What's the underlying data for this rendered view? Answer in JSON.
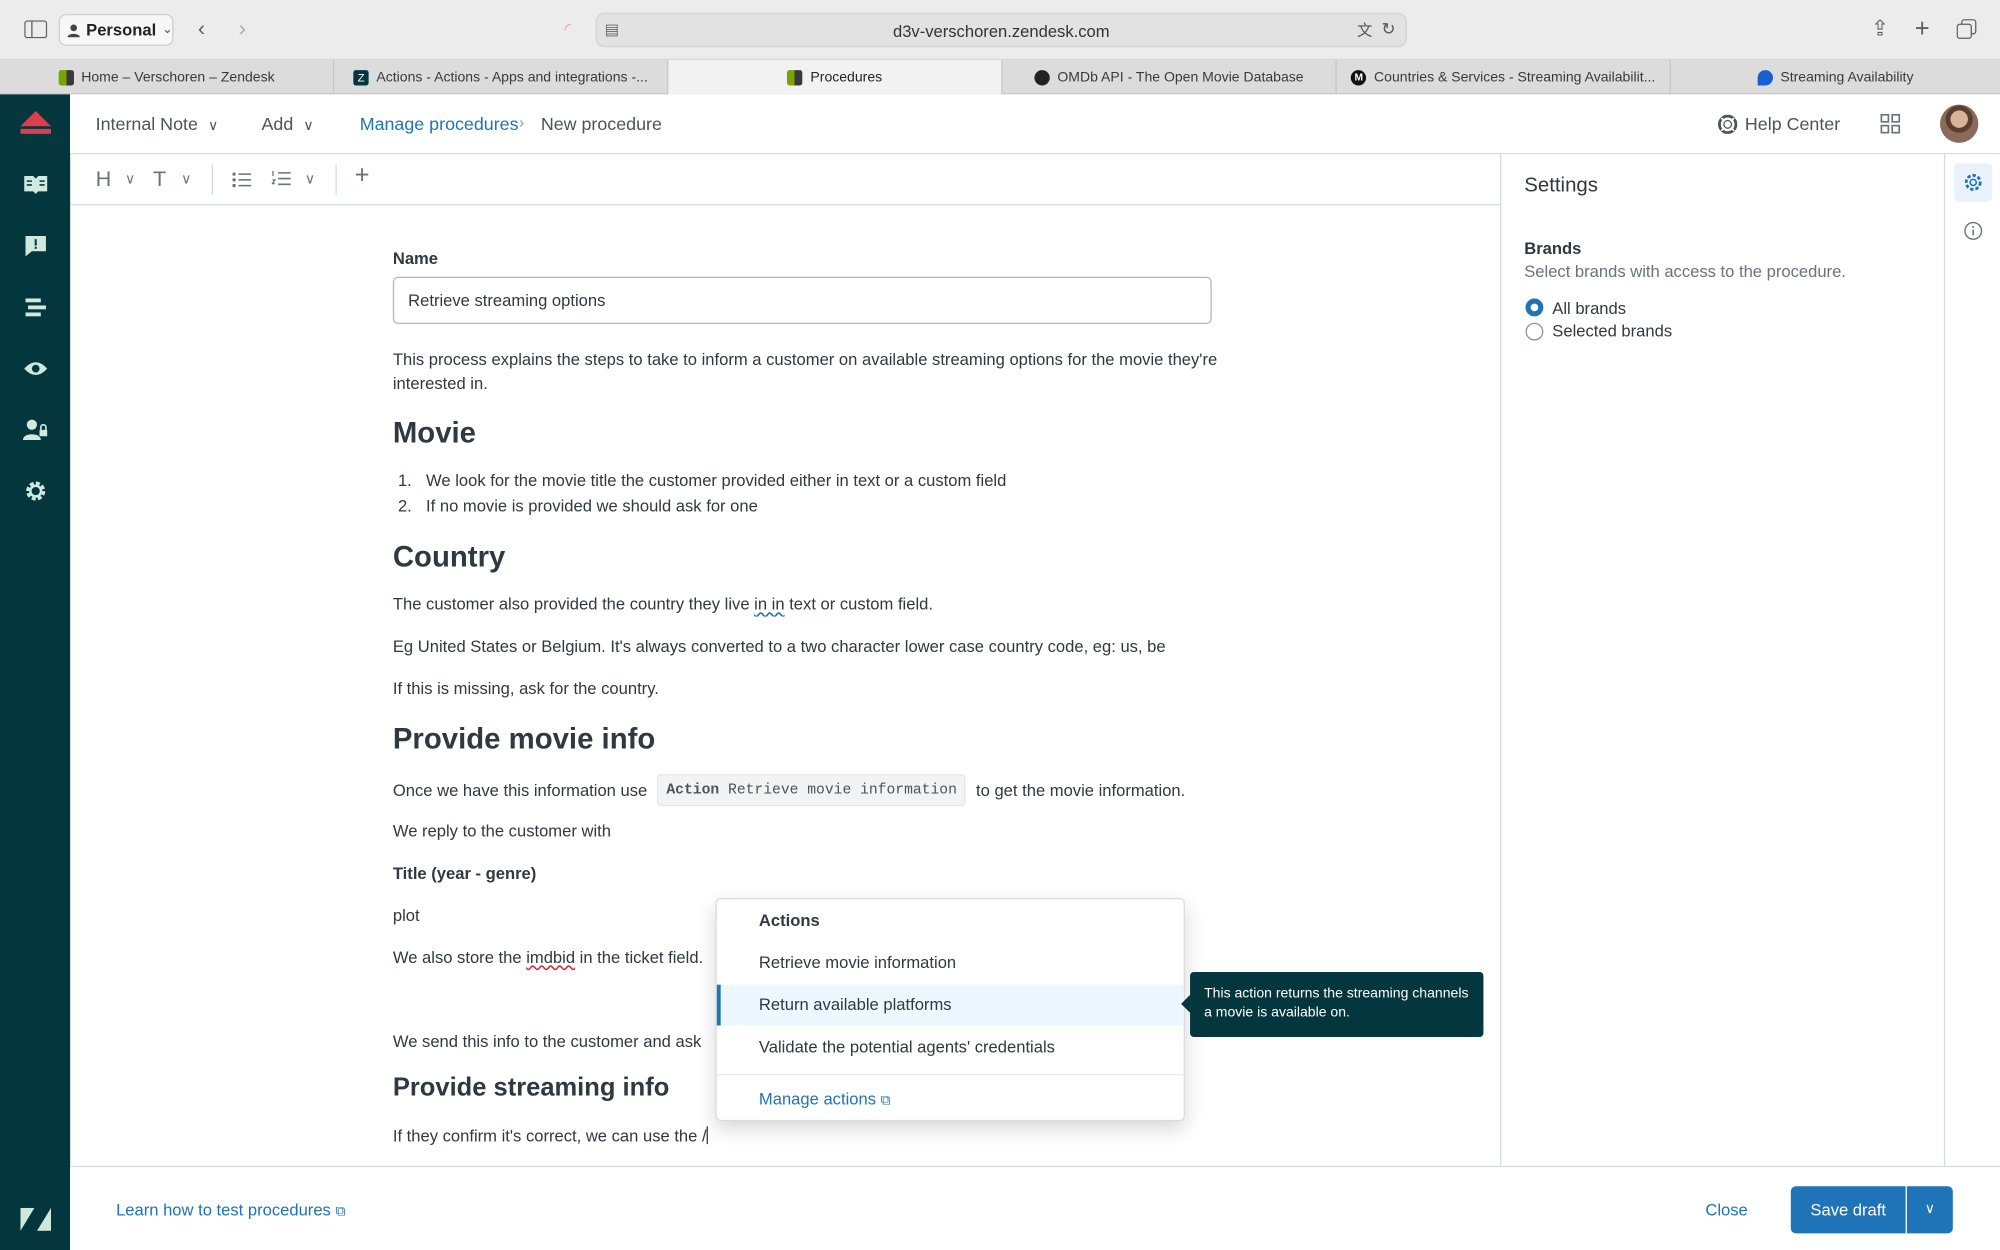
{
  "browser": {
    "profile": "Personal",
    "url": "d3v-verschoren.zendesk.com",
    "tabs": [
      {
        "label": "Home – Verschoren – Zendesk",
        "icon": "zendesk-logo-icon",
        "active": false
      },
      {
        "label": "Actions - Actions - Apps and integrations -...",
        "icon": "zendesk-z-icon",
        "active": false
      },
      {
        "label": "Procedures",
        "icon": "zendesk-logo-icon",
        "active": true
      },
      {
        "label": "OMDb API - The Open Movie Database",
        "icon": "omdb-icon",
        "active": false
      },
      {
        "label": "Countries & Services - Streaming Availabilit...",
        "icon": "movie-of-the-night-icon",
        "active": false
      },
      {
        "label": "Streaming Availability",
        "icon": "streaming-availability-icon",
        "active": false
      }
    ]
  },
  "header": {
    "internal_note": "Internal Note",
    "add": "Add",
    "breadcrumb_parent": "Manage procedures",
    "breadcrumb_current": "New procedure",
    "help_center": "Help Center"
  },
  "editor": {
    "name_label": "Name",
    "name_value": "Retrieve streaming options",
    "intro": "This process explains the steps to take to inform a customer on available streaming options for the movie they're interested in.",
    "h_movie": "Movie",
    "movie_steps": [
      "We look for the movie title the customer provided either in text or a custom field",
      "If no movie is provided we should ask for one"
    ],
    "h_country": "Country",
    "country_p1_a": "The customer also provided the country they live ",
    "country_p1_dup": "in in",
    "country_p1_b": " text or custom field.",
    "country_p2": "Eg United States or Belgium. It's always converted to a two character lower case country code, eg: us, be",
    "country_p3": "If this is missing, ask for the country.",
    "h_provide_movie": "Provide movie info",
    "movie_info_a": "Once we have this information use",
    "action_chip_kw": "Action",
    "action_chip_name": "Retrieve movie information",
    "movie_info_b": "to get the movie information.",
    "reply_line": "We reply to the customer with",
    "title_fmt": "Title (year - genre)",
    "plot": "plot",
    "store_a": "We also store the ",
    "store_word": "imdbid",
    "store_b": " in the ticket field.",
    "send_line": "We send this info to the customer and ask",
    "h_streaming": "Provide streaming info",
    "confirm_line": "If they confirm it's correct, we can use the /"
  },
  "actions_menu": {
    "heading": "Actions",
    "items": [
      "Retrieve movie information",
      "Return available platforms",
      "Validate the potential agents' credentials"
    ],
    "highlighted_index": 1,
    "manage": "Manage actions"
  },
  "tooltip": "This action returns the streaming channels a movie is available on.",
  "settings": {
    "title": "Settings",
    "brands_label": "Brands",
    "brands_hint": "Select brands with access to the procedure.",
    "options": [
      "All brands",
      "Selected brands"
    ],
    "selected": "All brands"
  },
  "footer": {
    "learn": "Learn how to test procedures",
    "close": "Close",
    "save": "Save draft"
  },
  "colors": {
    "nav_bg": "#03363d",
    "accent": "#1f73b7",
    "brand_red": "#d93f4c"
  }
}
